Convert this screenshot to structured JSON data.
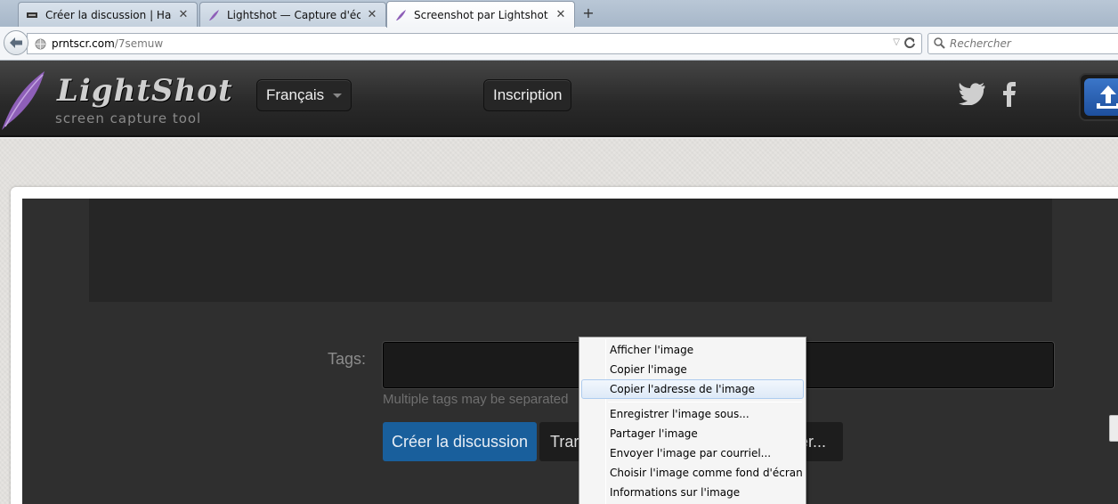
{
  "browser": {
    "tabs": [
      {
        "label": "Créer la discussion | Hack ...",
        "icon": "hackforums-favicon"
      },
      {
        "label": "Lightshot — Capture d'écr...",
        "icon": "lightshot-feather-favicon"
      },
      {
        "label": "Screenshot par Lightshot",
        "icon": "lightshot-feather-favicon"
      }
    ],
    "active_tab": 2,
    "close_glyph": "✕",
    "new_tab_glyph": "+",
    "url_host": "prntscr.com",
    "url_path": "/7semuw",
    "search_placeholder": "Rechercher"
  },
  "site": {
    "logo_title": "LightShot",
    "logo_subtitle": "screen capture tool",
    "language_button": "Français",
    "signup_button": "Inscription",
    "icons": [
      "twitter-icon",
      "facebook-icon",
      "upload-icon"
    ]
  },
  "form": {
    "tags_label": "Tags:",
    "tags_hint": "Multiple tags may be separated",
    "create_button": "Créer la discussion",
    "second_button_visible": "Trar",
    "third_button_visible": "er..."
  },
  "context_menu": {
    "items": [
      "Afficher l'image",
      "Copier l'image",
      "Copier l'adresse de l'image",
      "Enregistrer l'image sous...",
      "Partager l'image",
      "Envoyer l'image par courriel...",
      "Choisir l'image comme fond d'écran",
      "Informations sur l'image"
    ],
    "highlighted_index": 2
  },
  "colors": {
    "accent_blue": "#195f9c",
    "dark_panel": "#2f2f2f",
    "menu_highlight": "#dde9f7"
  }
}
